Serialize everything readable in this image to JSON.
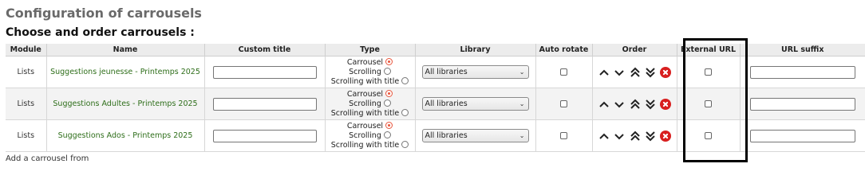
{
  "page": {
    "title": "Configuration of carrousels",
    "section_title": "Choose and order carrousels :"
  },
  "table": {
    "headers": [
      "Module",
      "Name",
      "Custom title",
      "Type",
      "Library",
      "Auto rotate",
      "Order",
      "External URL",
      "URL suffix"
    ],
    "type_options": [
      "Carrousel",
      "Scrolling",
      "Scrolling with title"
    ],
    "rows": [
      {
        "module": "Lists",
        "name": "Suggestions jeunesse - Printemps 2025",
        "custom_title": "",
        "type_selected": "Carrousel",
        "library": "All libraries",
        "auto_rotate": false,
        "external_url": false,
        "url_suffix": ""
      },
      {
        "module": "Lists",
        "name": "Suggestions Adultes - Printemps 2025",
        "custom_title": "",
        "type_selected": "Carrousel",
        "library": "All libraries",
        "auto_rotate": false,
        "external_url": false,
        "url_suffix": ""
      },
      {
        "module": "Lists",
        "name": "Suggestions Ados - Printemps 2025",
        "custom_title": "",
        "type_selected": "Carrousel",
        "library": "All libraries",
        "auto_rotate": false,
        "external_url": false,
        "url_suffix": ""
      }
    ]
  },
  "order_icons": [
    "chevron-up-icon",
    "chevron-down-icon",
    "double-chevron-up-icon",
    "double-chevron-down-icon",
    "delete-icon"
  ],
  "colors": {
    "list_name": "#2e6e1a",
    "delete": "#d81f1f",
    "radio_checked": "#e8553b",
    "highlight_border": "#000000"
  },
  "footer": {
    "partial_text": "Add a carrousel from"
  }
}
